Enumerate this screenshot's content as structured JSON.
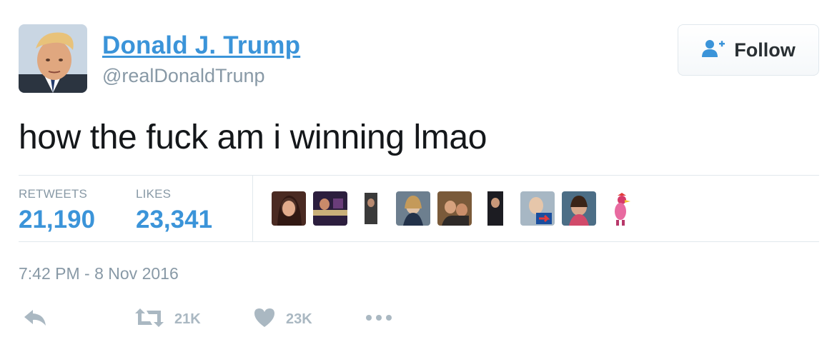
{
  "user": {
    "name": "Donald J. Trump",
    "handle": "@realDonaldTrunp"
  },
  "follow_button": {
    "label": "Follow",
    "icon": "add-user-icon"
  },
  "tweet": {
    "text": "how the fuck am i winning lmao",
    "timestamp": "7:42 PM - 8 Nov 2016"
  },
  "stats": {
    "retweets_label": "RETWEETS",
    "retweets_value": "21,190",
    "likes_label": "LIKES",
    "likes_value": "23,341"
  },
  "likers": [
    "avatar-1",
    "avatar-2",
    "avatar-3",
    "avatar-4",
    "avatar-5",
    "avatar-6",
    "avatar-7",
    "avatar-8",
    "avatar-9"
  ],
  "actions": {
    "reply_icon": "reply-icon",
    "retweet_icon": "retweet-icon",
    "retweet_count": "21K",
    "like_icon": "heart-icon",
    "like_count": "23K",
    "more_icon": "more-icon"
  },
  "colors": {
    "link": "#3b94d9",
    "muted": "#8899a6",
    "action_gray": "#aab8c2",
    "text": "#14171a",
    "border": "#e1e8ed"
  }
}
